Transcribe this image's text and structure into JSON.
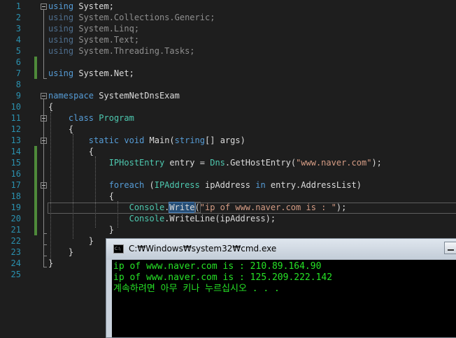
{
  "editor": {
    "line_numbers": [
      "1",
      "2",
      "3",
      "4",
      "5",
      "6",
      "7",
      "8",
      "9",
      "10",
      "11",
      "12",
      "13",
      "14",
      "15",
      "16",
      "17",
      "18",
      "19",
      "20",
      "21",
      "22",
      "23",
      "24",
      "25"
    ],
    "tokens": {
      "l1_kw": "using",
      "l1_rest": " System;",
      "l2_kw": "using",
      "l2_rest": " System.Collections.Generic;",
      "l3_kw": "using",
      "l3_rest": " System.Linq;",
      "l4_kw": "using",
      "l4_rest": " System.Text;",
      "l5_kw": "using",
      "l5_rest": " System.Threading.Tasks;",
      "l7_kw": "using",
      "l7_rest": " System.Net;",
      "l9_kw": "namespace",
      "l9_rest": " SystemNetDnsExam",
      "l10": "{",
      "l11_indent": "    ",
      "l11_kw": "class",
      "l11_sp": " ",
      "l11_ty": "Program",
      "l12": "    {",
      "l13_indent": "        ",
      "l13_kw1": "static",
      "l13_sp1": " ",
      "l13_kw2": "void",
      "l13_a": " Main(",
      "l13_kw3": "string",
      "l13_b": "[] args)",
      "l14": "        {",
      "l15_indent": "            ",
      "l15_ty1": "IPHostEntry",
      "l15_a": " entry = ",
      "l15_ty2": "Dns",
      "l15_b": ".GetHostEntry(",
      "l15_str": "\"www.naver.com\"",
      "l15_c": ");",
      "l17_indent": "            ",
      "l17_kw1": "foreach",
      "l17_a": " (",
      "l17_ty": "IPAddress",
      "l17_b": " ipAddress ",
      "l17_kw2": "in",
      "l17_c": " entry.AddressList)",
      "l18": "            {",
      "l19_indent": "                ",
      "l19_ty": "Console",
      "l19_dot": ".",
      "l19_hl": "Write",
      "l19_paren": "(",
      "l19_str": "\"ip of www.naver.com is : \"",
      "l19_end": ");",
      "l20_indent": "                ",
      "l20_ty": "Console",
      "l20_rest": ".WriteLine(ipAddress);",
      "l21": "            }",
      "l22": "        }",
      "l23": "    }",
      "l24": "}"
    }
  },
  "console_window": {
    "icon_label": "C:\\",
    "title": "C:₩Windows₩system32₩cmd.exe",
    "output": [
      "ip of www.naver.com is : 210.89.164.90",
      "ip of www.naver.com is : 125.209.222.142",
      "계속하려면 아무 키나 누르십시오 . . ."
    ]
  },
  "colors": {
    "background": "#1e1e1e",
    "keyword": "#569cd6",
    "type": "#4ec9b0",
    "string": "#d69d85",
    "line_number": "#2b91af",
    "console_text": "#26e326"
  }
}
